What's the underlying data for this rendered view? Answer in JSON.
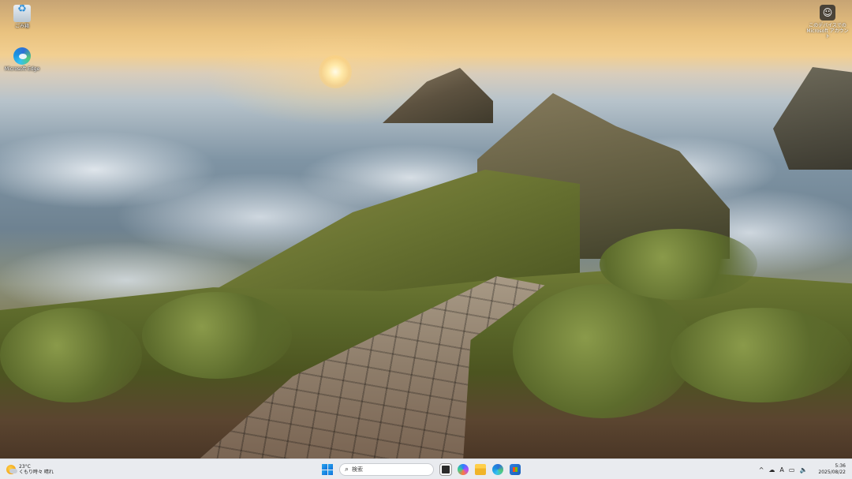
{
  "desktop": {
    "icons": [
      {
        "id": "recycle-bin",
        "label": "ごみ箱"
      },
      {
        "id": "edge",
        "label": "Microsoft Edge"
      }
    ],
    "account": {
      "icon": "account-circle-icon",
      "label_line1": "このデバイスでの",
      "label_line2": "Microsoft アカウント"
    }
  },
  "taskbar": {
    "weather": {
      "temp": "23°C",
      "condition": "くもり時々 晴れ",
      "icon": "partly-cloudy-icon"
    },
    "search": {
      "placeholder": "検索"
    },
    "apps": [
      "task-view-icon",
      "copilot-icon",
      "file-explorer-icon",
      "edge-icon",
      "store-icon"
    ],
    "tray": {
      "chevron": "^",
      "ime": "A",
      "time": "5:36",
      "date": "2025/08/22"
    }
  }
}
